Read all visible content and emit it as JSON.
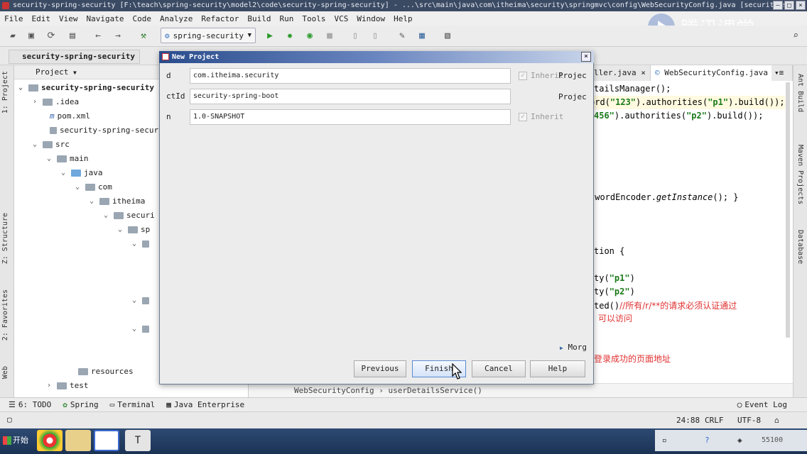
{
  "window": {
    "title": "security-spring-security [F:\\teach\\spring-security\\model2\\code\\security-spring-security] - ...\\src\\main\\java\\com\\itheima\\security\\springmvc\\config\\WebSecurityConfig.java [security-s..."
  },
  "watermark": {
    "text": "腾讯课堂"
  },
  "menu": [
    "File",
    "Edit",
    "View",
    "Navigate",
    "Code",
    "Analyze",
    "Refactor",
    "Build",
    "Run",
    "Tools",
    "VCS",
    "Window",
    "Help"
  ],
  "toolbar": {
    "run_config": "spring-security"
  },
  "breadcrumb": {
    "project": "security-spring-security"
  },
  "left_tabs": [
    "1: Project",
    "Z: Structure",
    "2: Favorites",
    "Web"
  ],
  "right_tabs": [
    "Ant Build",
    "Maven Projects",
    "Database"
  ],
  "project_panel": {
    "header": "Project",
    "tree": [
      {
        "label": "security-spring-security"
      },
      {
        "label": ".idea"
      },
      {
        "label": "pom.xml"
      },
      {
        "label": "security-spring-security"
      },
      {
        "label": "src"
      },
      {
        "label": "main"
      },
      {
        "label": "java"
      },
      {
        "label": "com"
      },
      {
        "label": "itheima"
      },
      {
        "label": "securi"
      },
      {
        "label": "sp"
      },
      {
        "label": "resources"
      },
      {
        "label": "test"
      }
    ]
  },
  "editor": {
    "tabs": [
      "ller.java",
      "WebSecurityConfig.java"
    ],
    "lines": {
      "l1": "tailsManager();",
      "l2a": "ord(",
      "l2b": "\"123\"",
      "l2c": ").authorities(",
      "l2d": "\"p1\"",
      "l2e": ").build());",
      "l3a": "456\"",
      "l3b": ").authorities(",
      "l3c": "\"p2\"",
      "l3d": ").build());",
      "l4a": "swordEncoder.",
      "l4b": "getInstance",
      "l4c": "(); }",
      "l5": "tion {",
      "l6a": "ty(",
      "l6b": "\"p1\"",
      "l6c": ")",
      "l7a": "ty(",
      "l7b": "\"p2\"",
      "l7c": ")",
      "l8a": "ted()",
      "l8b": "//所有/r/**的请求必须认证通过",
      "l9": "可以访问",
      "l10": "登录成功的页面地址"
    },
    "footer_crumb": "WebSecurityConfig  ›  userDetailsService()"
  },
  "dialog": {
    "title": "New Project",
    "fields": [
      {
        "label": "d",
        "value": "com.itheima.security",
        "extra": "Inherit",
        "extra2": "Projec"
      },
      {
        "label": "ctId",
        "value": "security-spring-boot",
        "extra2": "Projec"
      },
      {
        "label": "n",
        "value": "1.0-SNAPSHOT",
        "extra": "Inherit"
      }
    ],
    "more": "Morg",
    "buttons": {
      "previous": "Previous",
      "finish": "Finish",
      "cancel": "Cancel",
      "help": "Help"
    }
  },
  "bottom_tools": [
    "6: TODO",
    "Spring",
    "Terminal",
    "Java Enterprise"
  ],
  "event_log": "Event Log",
  "status": {
    "position": "24:88",
    "line_sep": "CRLF",
    "encoding": "UTF-8"
  },
  "taskbar": {
    "start": "开始",
    "clock": "55100"
  }
}
